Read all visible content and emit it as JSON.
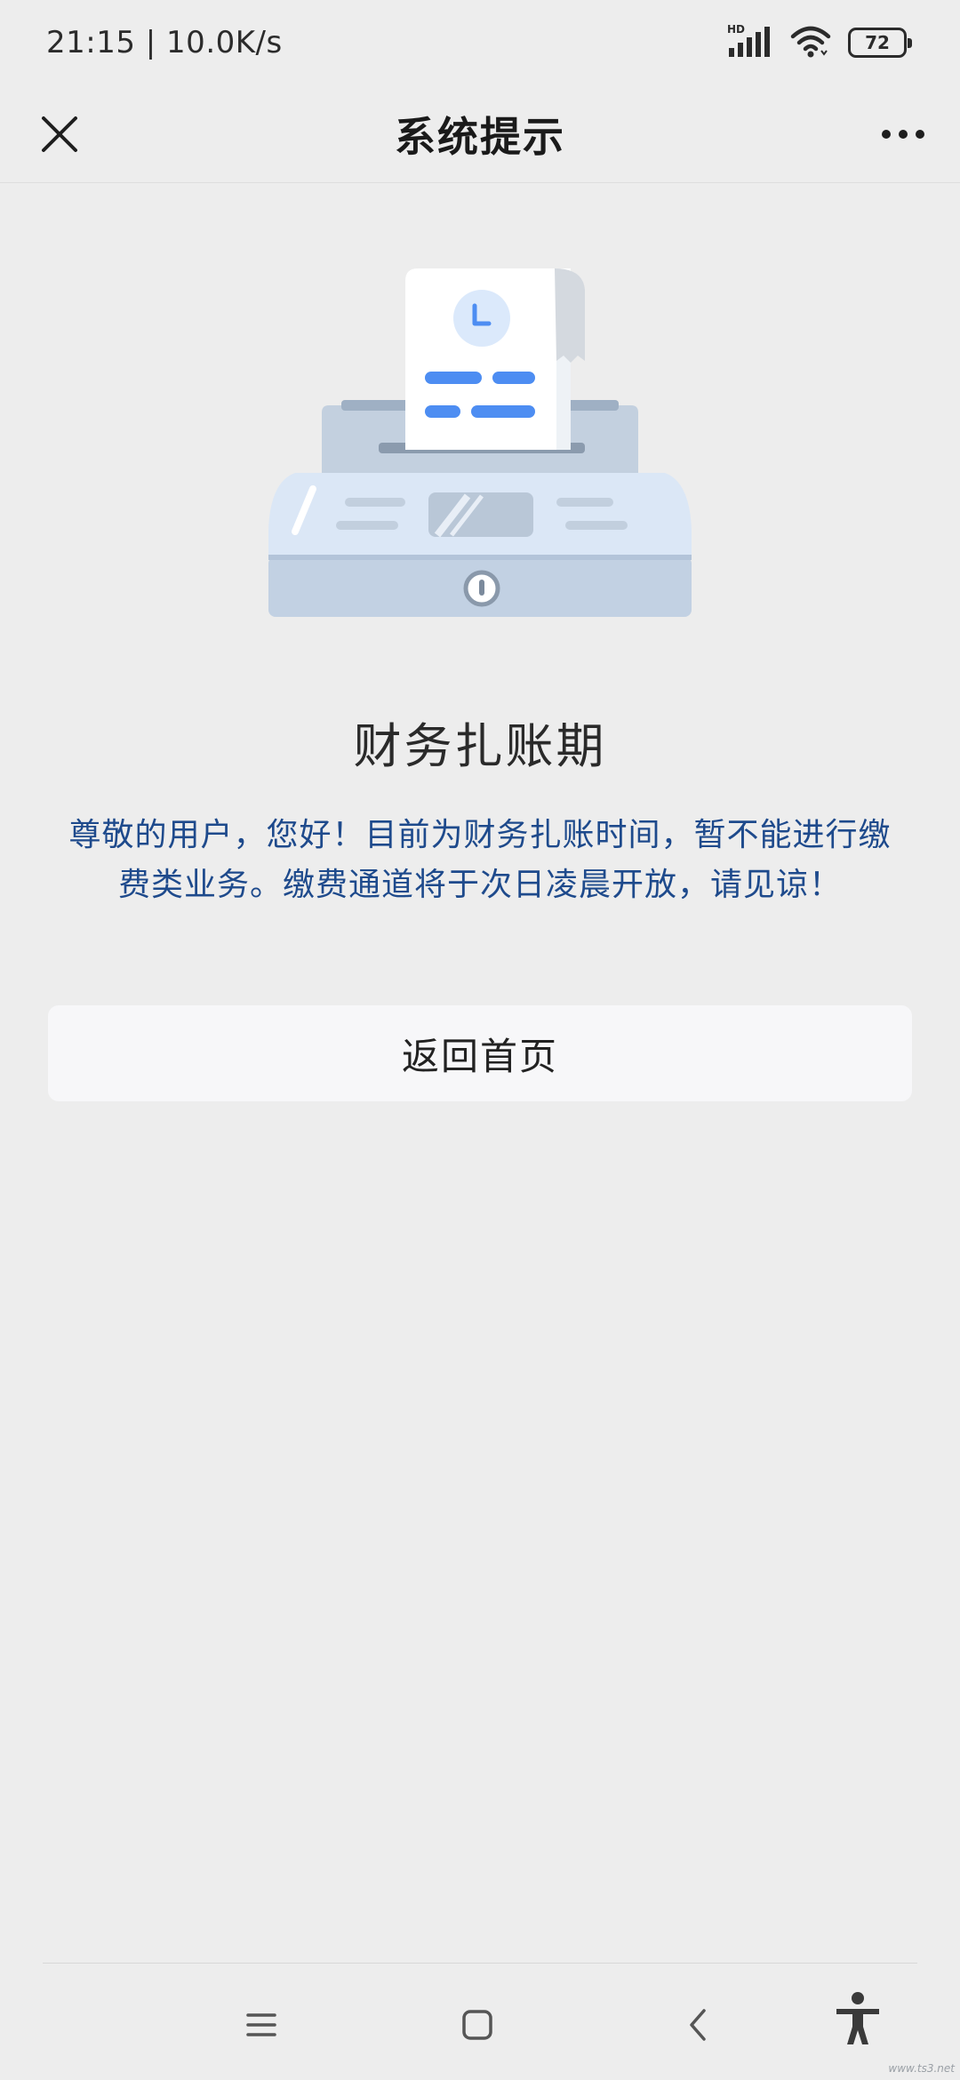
{
  "status_bar": {
    "time_speed": "21:15 | 10.0K/s",
    "network_badge": "HD",
    "battery_level": "72",
    "icons": [
      "signal-icon",
      "wifi-icon",
      "battery-icon"
    ]
  },
  "nav": {
    "title": "系统提示",
    "close_icon": "close-icon",
    "more_icon": "more-icon"
  },
  "content": {
    "heading": "财务扎账期",
    "message": "尊敬的用户，您好！目前为财务扎账时间，暂不能进行缴费类业务。缴费通道将于次日凌晨开放，请见谅！",
    "button_label": "返回首页"
  },
  "system_nav": {
    "icons": [
      "menu-icon",
      "home-icon",
      "back-icon",
      "accessibility-icon"
    ]
  },
  "watermark": "www.ts3.net",
  "colors": {
    "background": "#ededed",
    "message_text": "#1e4a8c",
    "accent_blue": "#4d8df2",
    "button_bg": "#f7f7f9"
  }
}
